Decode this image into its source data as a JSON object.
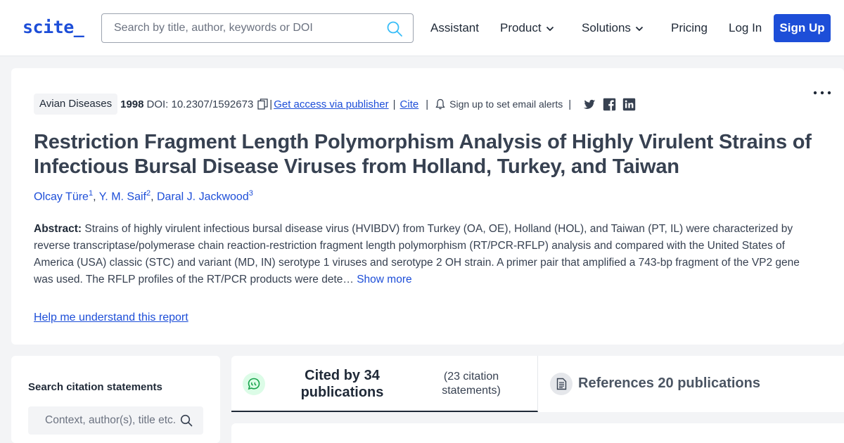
{
  "header": {
    "logo": "scite_",
    "search_placeholder": "Search by title, author, keywords or DOI",
    "nav": {
      "assistant": "Assistant",
      "product": "Product",
      "solutions": "Solutions",
      "pricing": "Pricing",
      "login": "Log In",
      "signup": "Sign Up"
    }
  },
  "paper": {
    "journal": "Avian Diseases",
    "year": "1998",
    "doi": "DOI: 10.2307/1592673",
    "access_link": "Get access via publisher",
    "cite_link": "Cite",
    "alerts": "Sign up to set email alerts",
    "title": "Restriction Fragment Length Polymorphism Analysis of Highly Virulent Strains of Infectious Bursal Disease Viruses from Holland, Turkey, and Taiwan",
    "authors": [
      {
        "name": "Olcay Türe",
        "sup": "1"
      },
      {
        "name": "Y. M. Saif",
        "sup": "2"
      },
      {
        "name": "Daral J. Jackwood",
        "sup": "3"
      }
    ],
    "abstract_label": "Abstract:",
    "abstract_text": "Strains of highly virulent infectious bursal disease virus (HVIBDV) from Turkey (OA, OE), Holland (HOL), and Taiwan (PT, IL) were characterized by reverse transcriptase/polymerase chain reaction-restriction fragment length polymorphism (RT/PCR-RFLP) analysis and compared with the United States of America (USA) classic (STC) and variant (MD, IN) serotype 1 viruses and serotype 2 OH strain. A primer pair that amplified a 743-bp fragment of the VP2 gene was used. The RFLP profiles of the RT/PCR products were dete…",
    "show_more": "Show more",
    "help_link": "Help me understand this report"
  },
  "left_panel": {
    "title": "Search citation statements",
    "search_placeholder": "Context, author(s), title etc."
  },
  "tabs": {
    "cited_by": "Cited by 34 publications",
    "cited_statements": "(23 citation statements)",
    "references": "References 20 publications"
  },
  "colors": {
    "brand": "#1d4ed8",
    "page_bg": "#f3f4f6",
    "cited_icon_bg": "#dcfce7",
    "cited_icon_fg": "#16a34a"
  }
}
